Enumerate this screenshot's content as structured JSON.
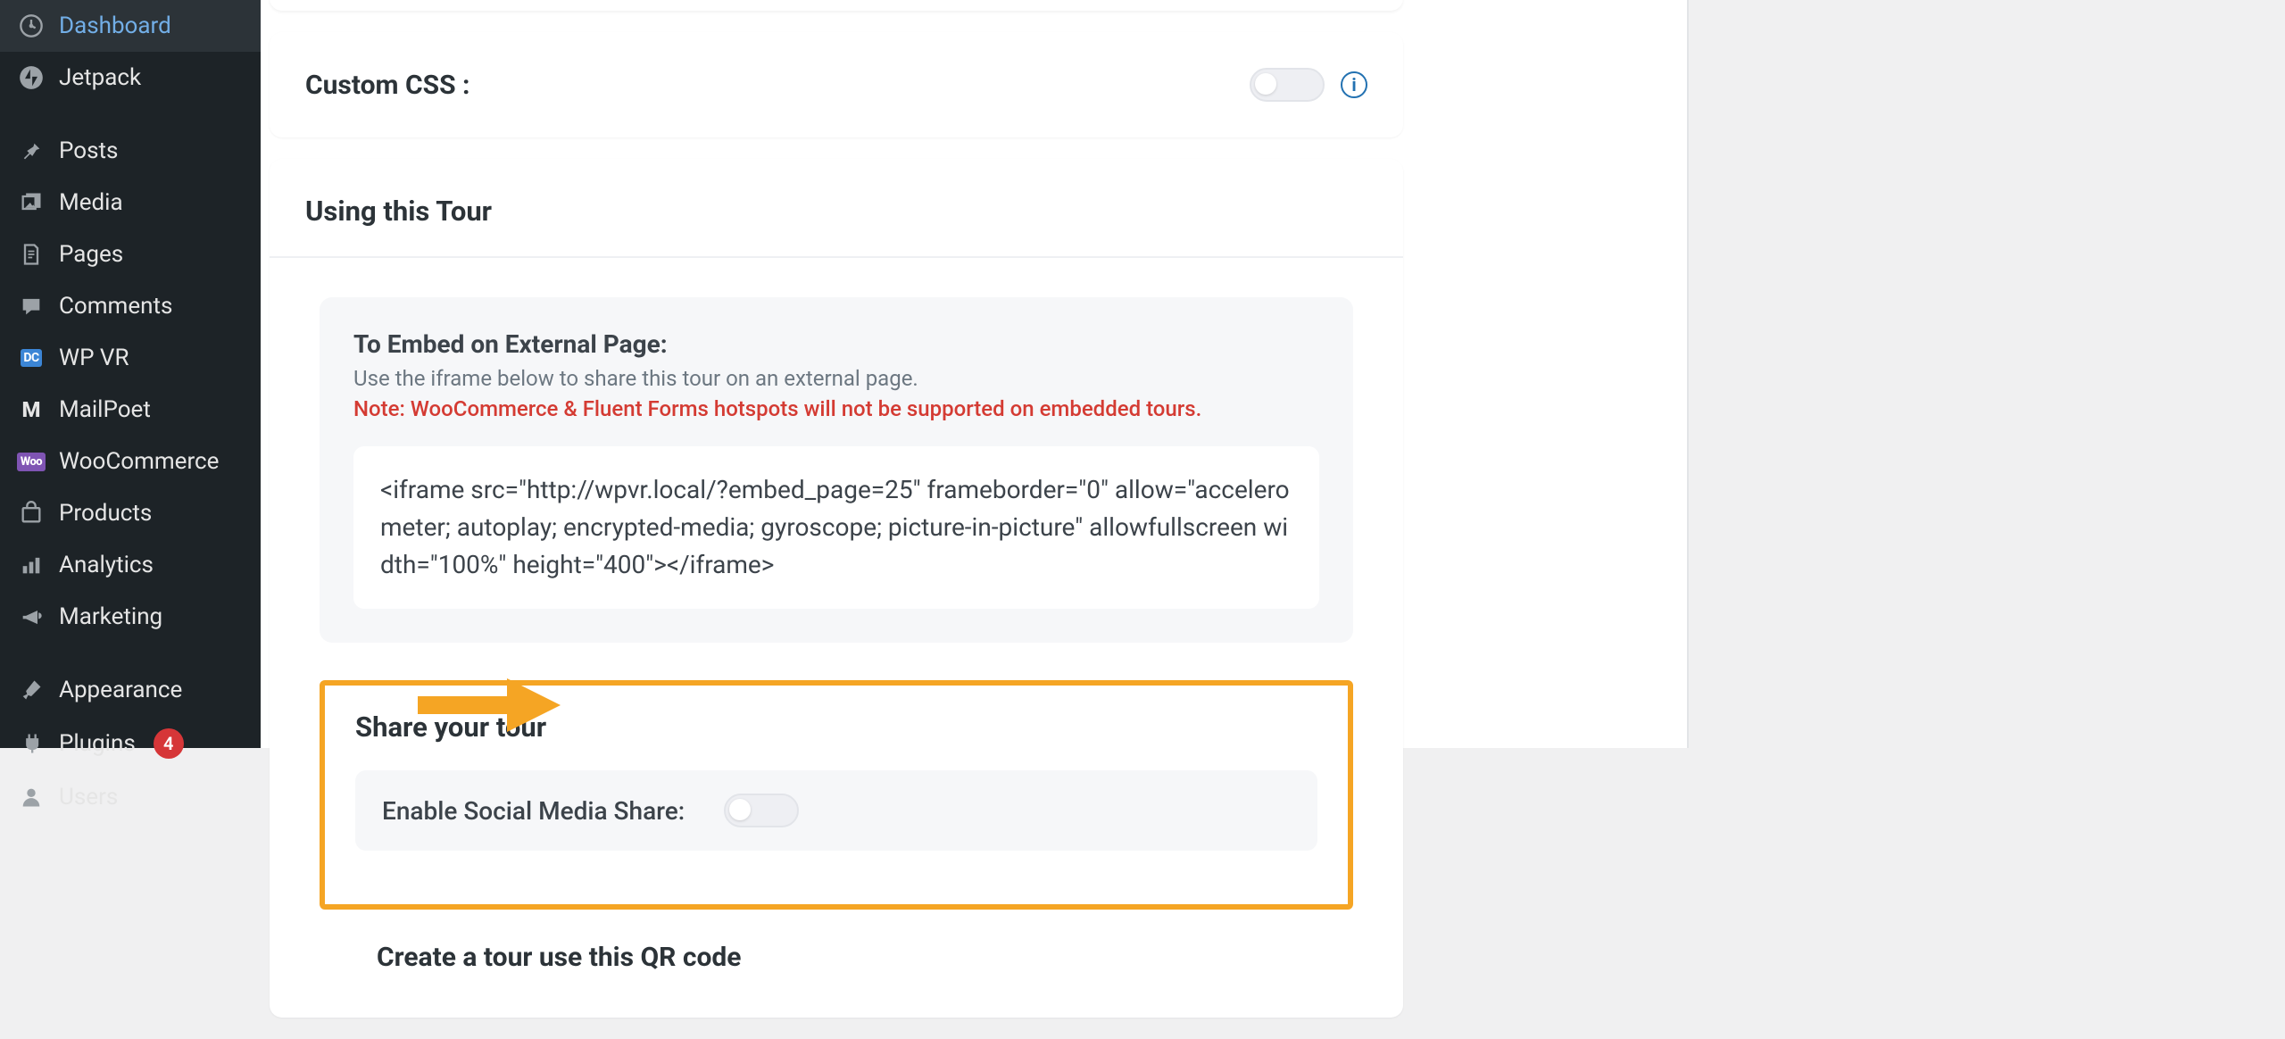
{
  "sidebar": {
    "items": [
      {
        "label": "Dashboard"
      },
      {
        "label": "Jetpack"
      },
      {
        "label": "Posts"
      },
      {
        "label": "Media"
      },
      {
        "label": "Pages"
      },
      {
        "label": "Comments"
      },
      {
        "label": "WP VR"
      },
      {
        "label": "MailPoet"
      },
      {
        "label": "WooCommerce"
      },
      {
        "label": "Products"
      },
      {
        "label": "Analytics"
      },
      {
        "label": "Marketing"
      },
      {
        "label": "Appearance"
      },
      {
        "label": "Plugins",
        "badge": "4"
      },
      {
        "label": "Users"
      }
    ]
  },
  "content": {
    "custom_css_label": "Custom CSS :",
    "using_tour_heading": "Using this Tour",
    "embed": {
      "title": "To Embed on External Page:",
      "subtitle": "Use the iframe below to share this tour on an external page.",
      "note": "Note: WooCommerce & Fluent Forms hotspots will not be supported on embedded tours.",
      "iframe_code": "<iframe src=\"http://wpvr.local/?embed_page=25\" frameborder=\"0\" allow=\"accelerometer; autoplay; encrypted-media; gyroscope; picture-in-picture\" allowfullscreen width=\"100%\" height=\"400\"></iframe>"
    },
    "share_heading": "Share your tour",
    "share_toggle_label": "Enable Social Media Share:",
    "qr_heading": "Create a tour use this QR code"
  }
}
